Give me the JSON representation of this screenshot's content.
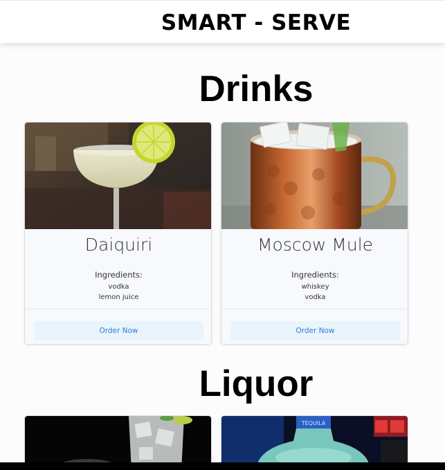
{
  "header": {
    "brand": "SMART - SERVE"
  },
  "sections": {
    "drinks": {
      "title": "Drinks",
      "cards": [
        {
          "name": "Daiquiri",
          "ingredients_label": "Ingredients:",
          "ingredients": [
            "vodka",
            "lemon juice"
          ],
          "button": "Order Now"
        },
        {
          "name": "Moscow Mule",
          "ingredients_label": "Ingredients:",
          "ingredients": [
            "whiskey",
            "vodka"
          ],
          "button": "Order Now"
        }
      ]
    },
    "liquor": {
      "title": "Liquor"
    }
  },
  "colors": {
    "button_bg": "#e9f4fd",
    "button_text": "#2f7dd3",
    "card_body_bg": "#f7f9fc"
  },
  "icons": [
    "daiquiri-photo",
    "moscow-mule-photo",
    "gin-tonic-photo",
    "tequila-bottle-photo"
  ]
}
